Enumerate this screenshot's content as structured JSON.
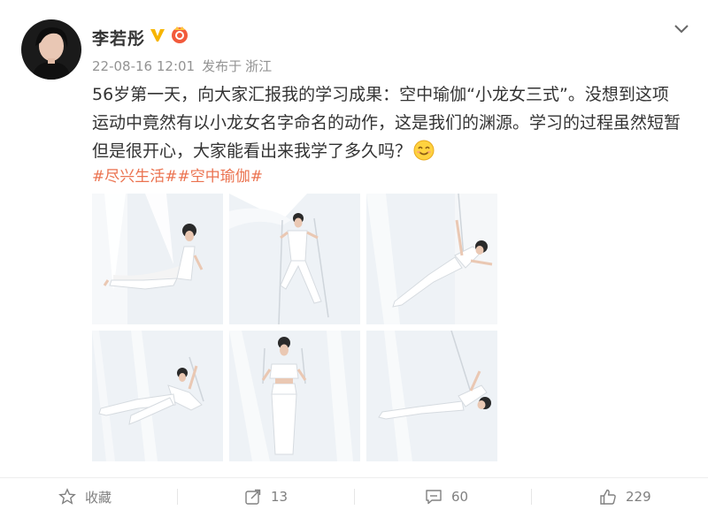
{
  "post": {
    "author": "李若彤",
    "date": "22-08-16 12:01",
    "via": "发布于",
    "location": "浙江",
    "text_line1": "56岁第一天，向大家汇报我的学习成果：空中瑜伽“小龙女三式”。没想到这项",
    "text_line2": "运动中竟然有以小龙女名字命名的动作，这是我们的渊源。学习的过程虽然短暂",
    "text_line3": "但是很开心，大家能看出来我学了多久吗？",
    "hashtag1": "#尽兴生活#",
    "hashtag2": "#空中瑜伽#"
  },
  "actions": {
    "favorite": "收藏",
    "repost": "13",
    "comment": "60",
    "like": "229"
  },
  "colors": {
    "accent": "#eb7350",
    "verified": "#f7b500",
    "muted": "#939393"
  },
  "icons": {
    "verified": "verified-v-icon",
    "vip": "vip-badge-icon",
    "collapse": "chevron-down-icon",
    "emoji": "smile-emoji-icon",
    "favorite": "star-icon",
    "repost": "repost-icon",
    "comment": "comment-icon",
    "like": "thumbs-up-icon"
  }
}
